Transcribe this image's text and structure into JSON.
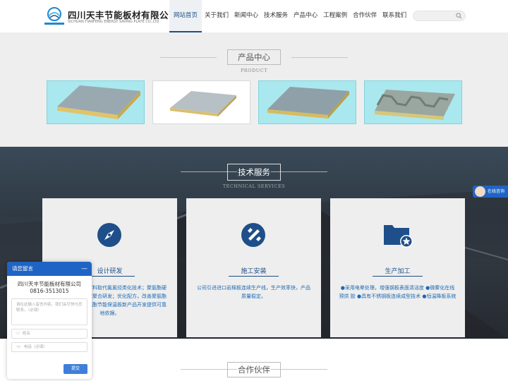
{
  "header": {
    "brand_cn": "四川天丰节能板材有限公司",
    "brand_en": "SICHUAN TIANFENG ENERGY SAVING PLATE CO.,LTD",
    "nav": [
      {
        "label": "网站首页",
        "active": true
      },
      {
        "label": "关于我们"
      },
      {
        "label": "新闻中心"
      },
      {
        "label": "技术服务"
      },
      {
        "label": "产品中心"
      },
      {
        "label": "工程案例"
      },
      {
        "label": "合作伙伴"
      },
      {
        "label": "联系我们"
      }
    ],
    "search_icon": "search-icon"
  },
  "products": {
    "title": "产品中心",
    "title_en": "PRODUCT"
  },
  "tech": {
    "title": "技术服务",
    "title_en": "TECHNICAL SERVICES",
    "cards": [
      {
        "icon": "compass-icon",
        "name": "设计研发",
        "desc": "聚氨酯硬质泡沫材料取代氟氯烃类化技术；聚氨酯硬泡阻燃技术及其它聚合研发；优化配方，改善聚氨酯硬质泡为公司聚氨酯节能保温板新产品开发提供可靠地依据。"
      },
      {
        "icon": "wrench-icon",
        "name": "施工安装",
        "desc": "公司引进进口岩棉板连续生产线，生产效率快，产品质量稳定。"
      },
      {
        "icon": "folder-star-icon",
        "name": "生产加工",
        "desc": "●采用电晕处理，增强钢板表面清洁度 ●微雾化在线预烘 胶 ●具有不锈钢板连续成型技术 ●恒温降板系统"
      }
    ]
  },
  "partners": {
    "title": "合作伙伴"
  },
  "message": {
    "title": "请您留言",
    "minimize": "—",
    "company": "四川天丰节能板材有限公司0816-3513015",
    "content_placeholder": "请在此输入留言内容，我们会尽快与您联系。（必填）",
    "name_placeholder": "姓名",
    "phone_placeholder": "电话（必填）",
    "submit": "提交"
  },
  "consult": {
    "label": "在线咨询"
  },
  "colors": {
    "brand_blue": "#1e4f8a",
    "card_cyan": "#a9e8ef",
    "widget_blue": "#1f64c4"
  }
}
